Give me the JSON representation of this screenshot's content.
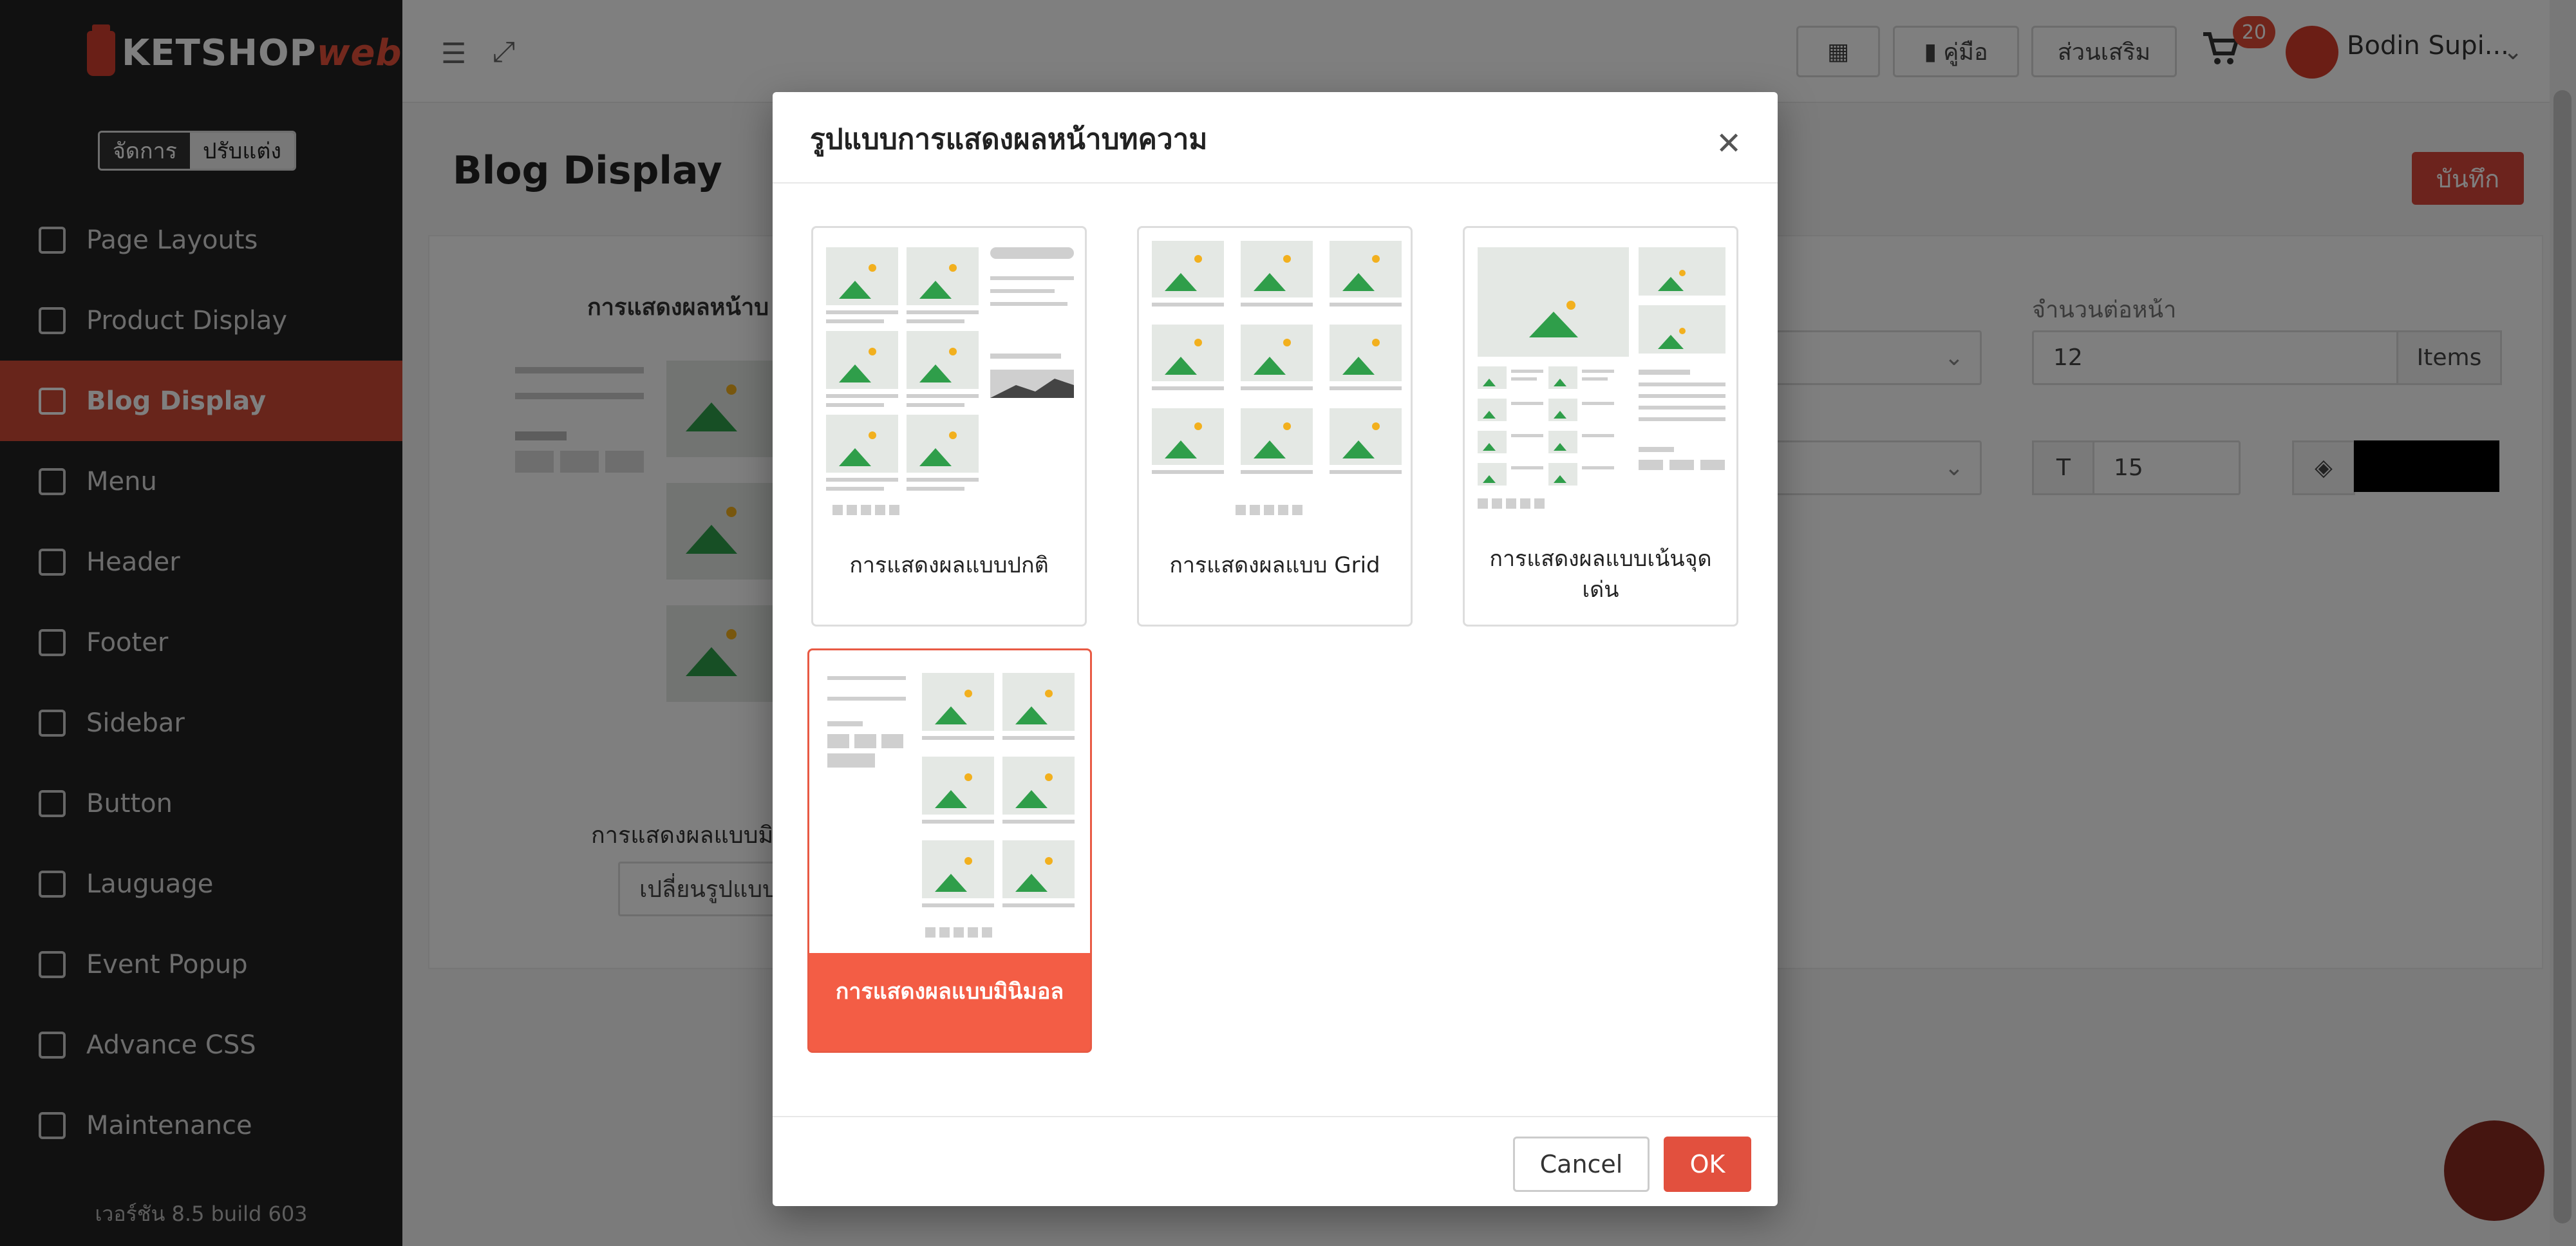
{
  "brand": {
    "logo_text": "KETSHOP",
    "logo_suffix": "web"
  },
  "sidebar": {
    "toggle": [
      "จัดการ",
      "ปรับแต่ง"
    ],
    "items": [
      {
        "label": "Page Layouts",
        "icon": "layout-icon"
      },
      {
        "label": "Product Display",
        "icon": "grid-icon"
      },
      {
        "label": "Blog Display",
        "icon": "blog-icon",
        "active": true
      },
      {
        "label": "Menu",
        "icon": "menu-icon"
      },
      {
        "label": "Header",
        "icon": "header-icon"
      },
      {
        "label": "Footer",
        "icon": "footer-icon"
      },
      {
        "label": "Sidebar",
        "icon": "sidebar-icon"
      },
      {
        "label": "Button",
        "icon": "toggle-icon"
      },
      {
        "label": "Lauguage",
        "icon": "language-icon"
      },
      {
        "label": "Event Popup",
        "icon": "popup-icon"
      },
      {
        "label": "Advance CSS",
        "icon": "css-icon"
      },
      {
        "label": "Maintenance",
        "icon": "bug-icon"
      }
    ],
    "version": "เวอร์ชัน 8.5 build 603"
  },
  "topbar": {
    "manual_label": "คู่มือ",
    "addons_label": "ส่วนเสริม",
    "cart_count": "20",
    "user_name": "Bodin Supi..."
  },
  "main": {
    "page_title": "Blog Display",
    "save_label": "บันทึก",
    "section_label": "การแสดงผลหน้าบ",
    "layout_label": "การแสดงผลแบบมิ",
    "change_label": "เปลี่ยนรูปแบบ",
    "per_page_label": "จำนวนต่อหน้า",
    "per_page_value": "12",
    "per_page_unit": "Items",
    "font_size_value": "15"
  },
  "modal": {
    "title": "รูปแบบการแสดงผลหน้าบทความ",
    "options": [
      {
        "label": "การแสดงผลแบบปกติ"
      },
      {
        "label": "การแสดงผลแบบ Grid"
      },
      {
        "label": "การแสดงผลแบบเน้นจุดเด่น"
      },
      {
        "label": "การแสดงผลแบบมินิมอล",
        "selected": true
      }
    ],
    "cancel_label": "Cancel",
    "ok_label": "OK"
  },
  "colors": {
    "accent": "#e2503e",
    "sidebar_bg": "#222222",
    "image_green": "#2f9e4a",
    "image_sun": "#f2b01e"
  }
}
